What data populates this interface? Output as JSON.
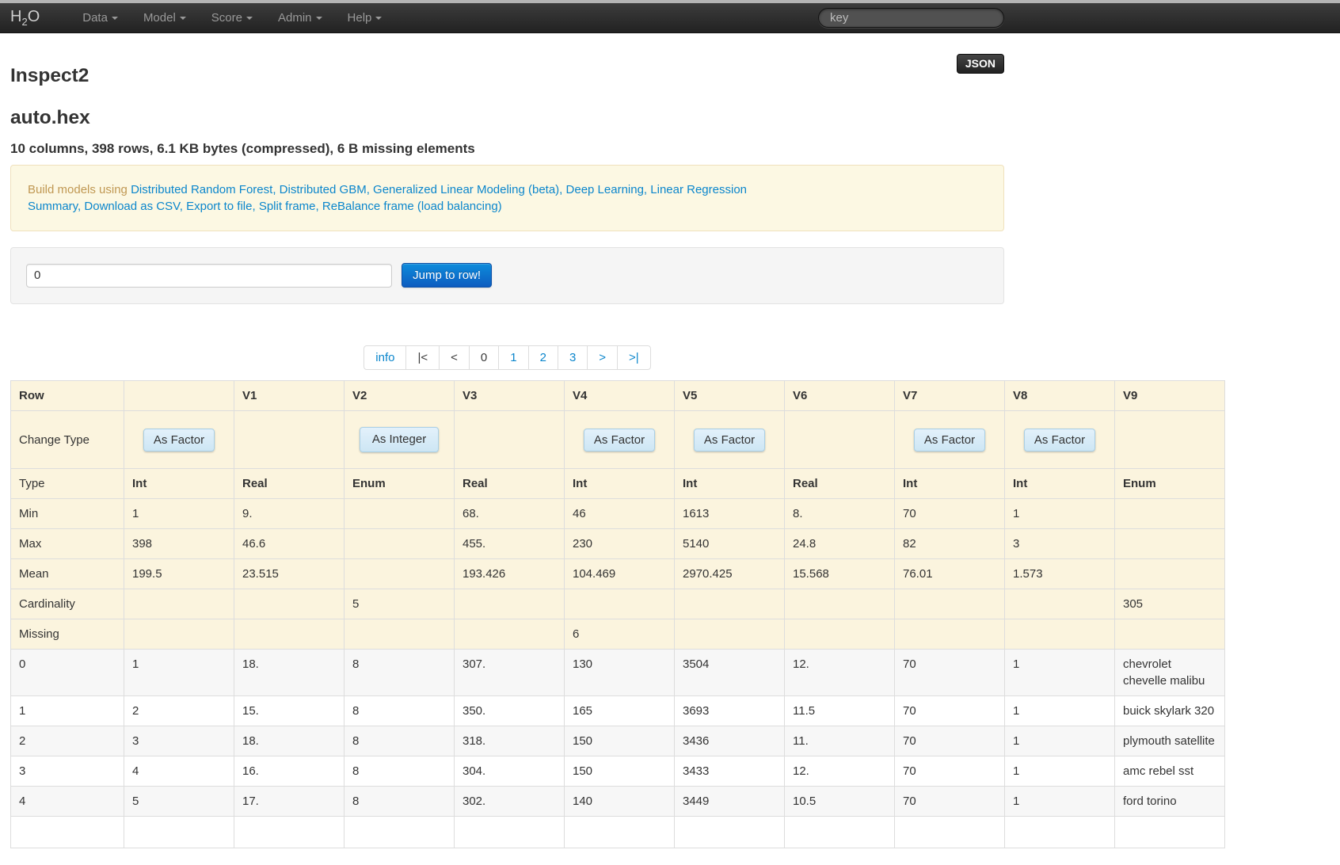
{
  "navbar": {
    "brand_h": "H",
    "brand_sub": "2",
    "brand_o": "O",
    "menus": [
      {
        "label": "Data"
      },
      {
        "label": "Model"
      },
      {
        "label": "Score"
      },
      {
        "label": "Admin"
      },
      {
        "label": "Help"
      }
    ],
    "search_placeholder": "key"
  },
  "page": {
    "title": "Inspect2",
    "json_button": "JSON",
    "frame_name": "auto.hex",
    "summary": "10 columns, 398 rows, 6.1 KB bytes (compressed), 6 B missing elements"
  },
  "alert": {
    "prefix": "Build models using",
    "model_links": [
      "Distributed Random Forest",
      "Distributed GBM",
      "Generalized Linear Modeling (beta)",
      "Deep Learning",
      "Linear Regression"
    ],
    "action_links": [
      "Summary",
      "Download as CSV",
      "Export to file",
      "Split frame",
      "ReBalance frame (load balancing)"
    ]
  },
  "jump": {
    "input_value": "0",
    "button_label": "Jump to row!"
  },
  "pagination": [
    {
      "label": "info",
      "type": "link"
    },
    {
      "label": "|<",
      "type": "disabled"
    },
    {
      "label": "<",
      "type": "disabled"
    },
    {
      "label": "0",
      "type": "current"
    },
    {
      "label": "1",
      "type": "link"
    },
    {
      "label": "2",
      "type": "link"
    },
    {
      "label": "3",
      "type": "link"
    },
    {
      "label": ">",
      "type": "link"
    },
    {
      "label": ">|",
      "type": "link"
    }
  ],
  "table": {
    "headers": [
      "Row",
      "",
      "V1",
      "V2",
      "V3",
      "V4",
      "V5",
      "V6",
      "V7",
      "V8",
      "V9"
    ],
    "change_type": {
      "label": "Change Type",
      "buttons": [
        "As Factor",
        "",
        "As Integer",
        "",
        "As Factor",
        "As Factor",
        "",
        "As Factor",
        "As Factor",
        ""
      ]
    },
    "stat_rows": [
      {
        "label": "Type",
        "bold": true,
        "values": [
          "Int",
          "Real",
          "Enum",
          "Real",
          "Int",
          "Int",
          "Real",
          "Int",
          "Int",
          "Enum"
        ]
      },
      {
        "label": "Min",
        "values": [
          "1",
          "9.",
          "",
          "68.",
          "46",
          "1613",
          "8.",
          "70",
          "1",
          ""
        ]
      },
      {
        "label": "Max",
        "values": [
          "398",
          "46.6",
          "",
          "455.",
          "230",
          "5140",
          "24.8",
          "82",
          "3",
          ""
        ]
      },
      {
        "label": "Mean",
        "values": [
          "199.5",
          "23.515",
          "",
          "193.426",
          "104.469",
          "2970.425",
          "15.568",
          "76.01",
          "1.573",
          ""
        ]
      },
      {
        "label": "Cardinality",
        "values": [
          "",
          "",
          "5",
          "",
          "",
          "",
          "",
          "",
          "",
          "305"
        ]
      },
      {
        "label": "Missing",
        "values": [
          "",
          "",
          "",
          "",
          "6",
          "",
          "",
          "",
          "",
          ""
        ]
      }
    ],
    "data_rows": [
      {
        "label": "0",
        "values": [
          "1",
          "18.",
          "8",
          "307.",
          "130",
          "3504",
          "12.",
          "70",
          "1",
          "chevrolet chevelle malibu"
        ]
      },
      {
        "label": "1",
        "values": [
          "2",
          "15.",
          "8",
          "350.",
          "165",
          "3693",
          "11.5",
          "70",
          "1",
          "buick skylark 320"
        ]
      },
      {
        "label": "2",
        "values": [
          "3",
          "18.",
          "8",
          "318.",
          "150",
          "3436",
          "11.",
          "70",
          "1",
          "plymouth satellite"
        ]
      },
      {
        "label": "3",
        "values": [
          "4",
          "16.",
          "8",
          "304.",
          "150",
          "3433",
          "12.",
          "70",
          "1",
          "amc rebel sst"
        ]
      },
      {
        "label": "4",
        "values": [
          "5",
          "17.",
          "8",
          "302.",
          "140",
          "3449",
          "10.5",
          "70",
          "1",
          "ford torino"
        ]
      }
    ]
  },
  "colors": {
    "link_blue": "#0b86cc",
    "warning_text": "#c09853",
    "warning_bg": "#fcf8e3",
    "table_head_bg": "#fbf4de",
    "stripe_bg": "#f7f7f7",
    "primary_button_blue": "#0d6fce",
    "type_button_bg": "#cde6f4",
    "navbar_bg": "#222222"
  }
}
